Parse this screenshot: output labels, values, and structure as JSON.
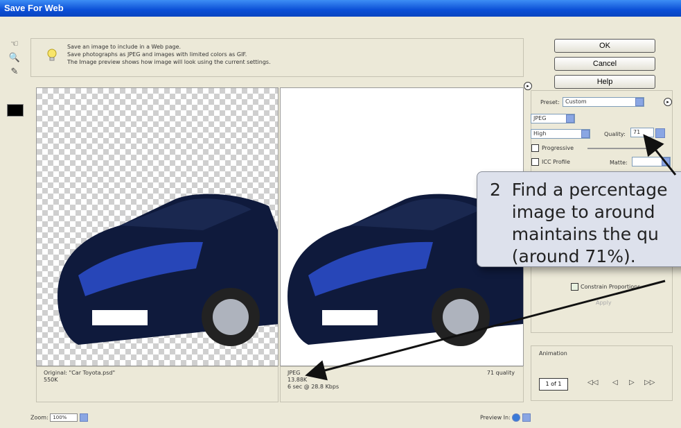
{
  "window": {
    "title": "Save For Web"
  },
  "info": {
    "lines": [
      "Save an image to include in a Web page.",
      "Save photographs as JPEG and images with limited colors as GIF.",
      "The Image preview shows how image will look using the current settings."
    ]
  },
  "buttons": {
    "ok": "OK",
    "cancel": "Cancel",
    "help": "Help"
  },
  "settings": {
    "preset_label": "Preset:",
    "preset_value": "Custom",
    "format": "JPEG",
    "compression": "High",
    "quality_label": "Quality:",
    "quality_value": "71",
    "progressive_label": "Progressive",
    "icc_label": "ICC Profile",
    "matte_label": "Matte:",
    "constrain_label": "Constrain Proportions",
    "apply_label": "Apply"
  },
  "captions": {
    "original_line1": "Original: \"Car Toyota.psd\"",
    "original_line2": "550K",
    "optimized_line1": "JPEG",
    "optimized_line2": "13.88K",
    "optimized_line3": "6 sec @ 28.8 Kbps",
    "optimized_quality": "71 quality"
  },
  "animation": {
    "label": "Animation",
    "frame": "1 of 1"
  },
  "footer": {
    "zoom_label": "Zoom:",
    "zoom_value": "100%",
    "preview_label": "Preview In:"
  },
  "callout": {
    "line1": "2  Find a percentage",
    "line2": "    image to around",
    "line3": "    maintains the qu",
    "line4": "    (around 71%)."
  }
}
